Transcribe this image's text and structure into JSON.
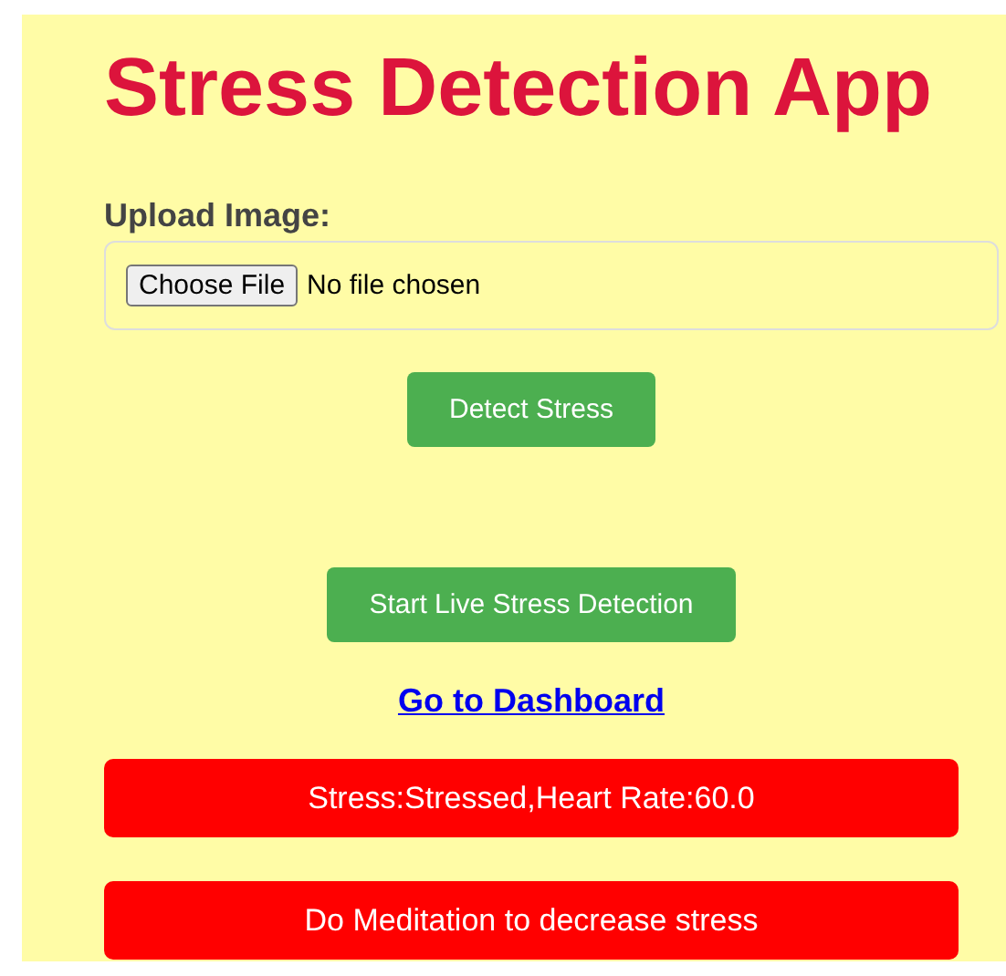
{
  "title": "Stress Detection App",
  "upload": {
    "label": "Upload Image:",
    "button": "Choose File",
    "status": "No file chosen"
  },
  "buttons": [
    {
      "kind": "detect",
      "label": "Detect Stress"
    },
    {
      "kind": "live",
      "label": "Start Live Stress Detection"
    }
  ],
  "link": "Go to Dashboard",
  "results": [
    "Stress:Stressed,Heart Rate:60.0",
    "Do Meditation to decrease stress"
  ]
}
